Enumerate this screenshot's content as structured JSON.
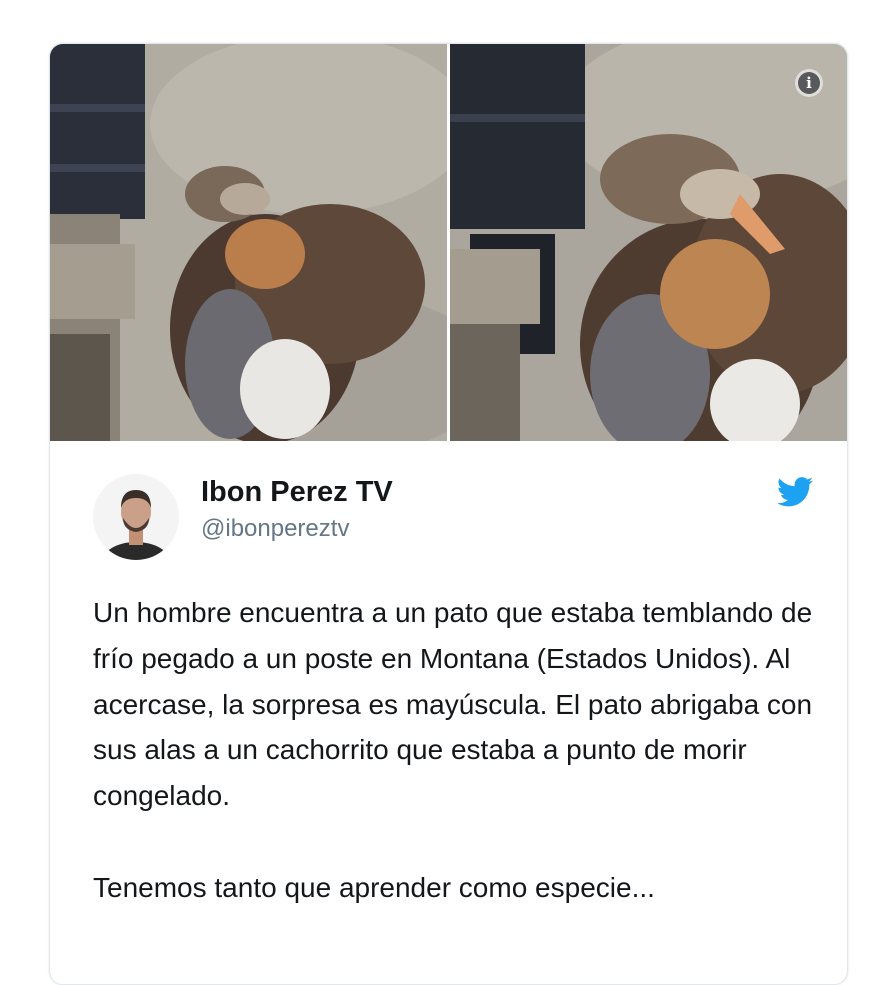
{
  "tweet": {
    "display_name": "Ibon Perez TV",
    "handle": "@ibonpereztv",
    "text": "Un hombre encuentra a un pato que estaba temblando de frío pegado a un poste en Montana (Estados Unidos). Al acercase, la sorpresa es mayúscula. El pato abrigaba con sus alas a un cachorrito que estaba a punto de morir congelado.\n\nTenemos tanto que aprender como especie...",
    "info_glyph": "i"
  },
  "icons": {
    "info": "info-icon",
    "platform": "twitter-bird-icon"
  },
  "colors": {
    "twitter_blue": "#1da1f2",
    "text": "#14171a",
    "handle": "#657786",
    "card_border": "#e1e8ed"
  }
}
